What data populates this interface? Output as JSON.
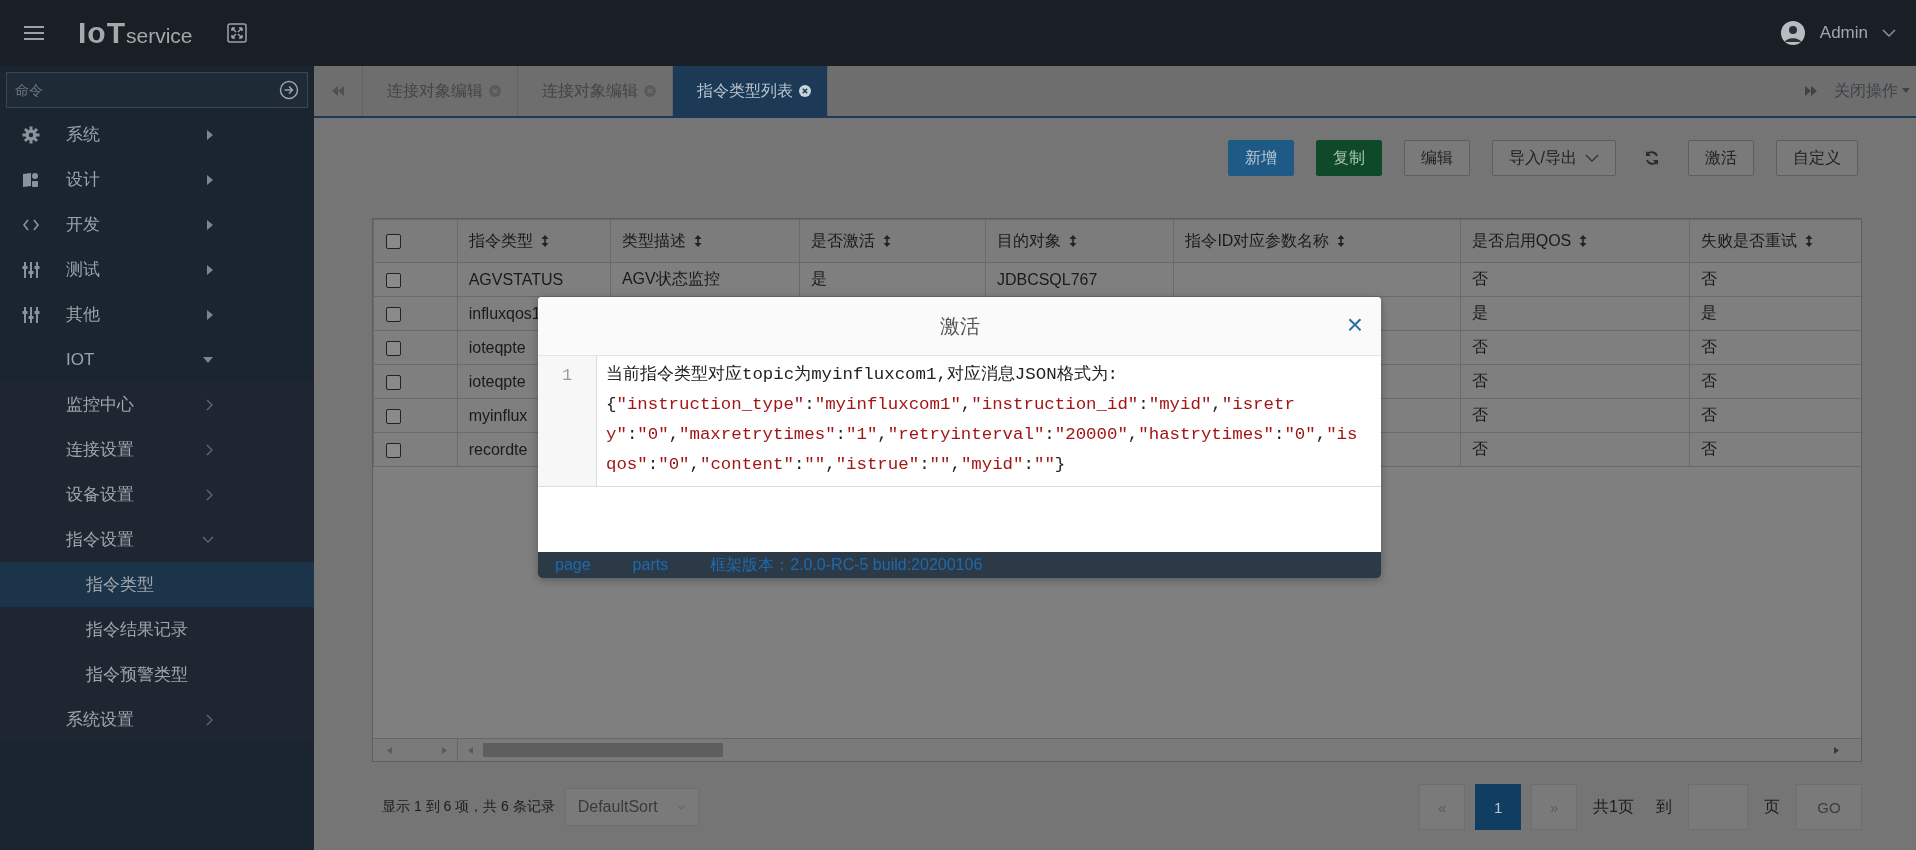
{
  "header": {
    "logo": {
      "main": "IoT",
      "sub": "service"
    },
    "user": "Admin"
  },
  "sidebar": {
    "search": {
      "placeholder": "命令"
    },
    "items": [
      {
        "label": "系统",
        "expanded": false
      },
      {
        "label": "设计",
        "expanded": false
      },
      {
        "label": "开发",
        "expanded": false
      },
      {
        "label": "测试",
        "expanded": false
      },
      {
        "label": "其他",
        "expanded": false
      },
      {
        "label": "IOT",
        "expanded": true,
        "children": [
          {
            "label": "监控中心",
            "expanded": false
          },
          {
            "label": "连接设置",
            "expanded": false
          },
          {
            "label": "设备设置",
            "expanded": false
          },
          {
            "label": "指令设置",
            "expanded": true,
            "children": [
              {
                "label": "指令类型",
                "selected": true
              },
              {
                "label": "指令结果记录",
                "selected": false
              },
              {
                "label": "指令预警类型",
                "selected": false
              }
            ]
          },
          {
            "label": "系统设置",
            "expanded": false
          }
        ]
      }
    ]
  },
  "tabs": [
    {
      "label": "连接对象编辑",
      "selected": false
    },
    {
      "label": "连接对象编辑",
      "selected": false
    },
    {
      "label": "指令类型列表",
      "selected": true
    }
  ],
  "close_menu": "关闭操作",
  "toolbar": [
    {
      "label": "新增",
      "kind": "primary"
    },
    {
      "label": "复制",
      "kind": "success"
    },
    {
      "label": "编辑",
      "kind": "default"
    },
    {
      "label": "导入/导出",
      "kind": "dropdown"
    },
    {
      "kind": "refresh"
    },
    {
      "label": "激活",
      "kind": "default"
    },
    {
      "label": "自定义",
      "kind": "default"
    }
  ],
  "table": {
    "all_checked": false,
    "columns": [
      "指令类型",
      "类型描述",
      "是否激活",
      "目的对象",
      "指令ID对应参数名称",
      "是否启用QOS",
      "失败是否重试"
    ],
    "rows": [
      {
        "checked": false,
        "cells": [
          "AGVSTATUS",
          "AGV状态监控",
          "是",
          "JDBCSQL767",
          null,
          "否",
          "否"
        ]
      },
      {
        "checked": false,
        "cells": [
          "influxqos1",
          null,
          null,
          null,
          null,
          "是",
          "是"
        ]
      },
      {
        "checked": false,
        "cells": [
          "ioteqpte",
          null,
          null,
          null,
          null,
          "否",
          "否"
        ]
      },
      {
        "checked": false,
        "cells": [
          "ioteqpte",
          null,
          null,
          null,
          null,
          "否",
          "否"
        ]
      },
      {
        "checked": false,
        "cells": [
          "myinflux",
          null,
          null,
          null,
          null,
          "否",
          "否"
        ]
      },
      {
        "checked": false,
        "cells": [
          "recordte",
          null,
          null,
          null,
          null,
          "否",
          "否"
        ]
      }
    ]
  },
  "pagination": {
    "summary": "显示 1 到 6 项，共 6 条记录",
    "sort": "DefaultSort",
    "prev": "«",
    "pages": [
      {
        "label": "1",
        "selected": true
      }
    ],
    "next": "»",
    "total": "共1页",
    "goto": "到",
    "page_unit": "页",
    "go": "GO"
  },
  "modal": {
    "title": "激活",
    "close": "×",
    "line_number": "1",
    "intro": "当前指令类型对应topic为myinfluxcom1,对应消息JSON格式为:",
    "json": "{\"instruction_type\":\"myinfluxcom1\",\"instruction_id\":\"myid\",\"isretry\":\"0\",\"maxretrytimes\":\"1\",\"retryinterval\":\"20000\",\"hastrytimes\":\"0\",\"isqos\":\"0\",\"content\":\"\",\"istrue\":\"\",\"myid\":\"\"}",
    "footer": [
      "page",
      "parts",
      "框架版本：2.0.0-RC-5 build:20200106"
    ]
  }
}
